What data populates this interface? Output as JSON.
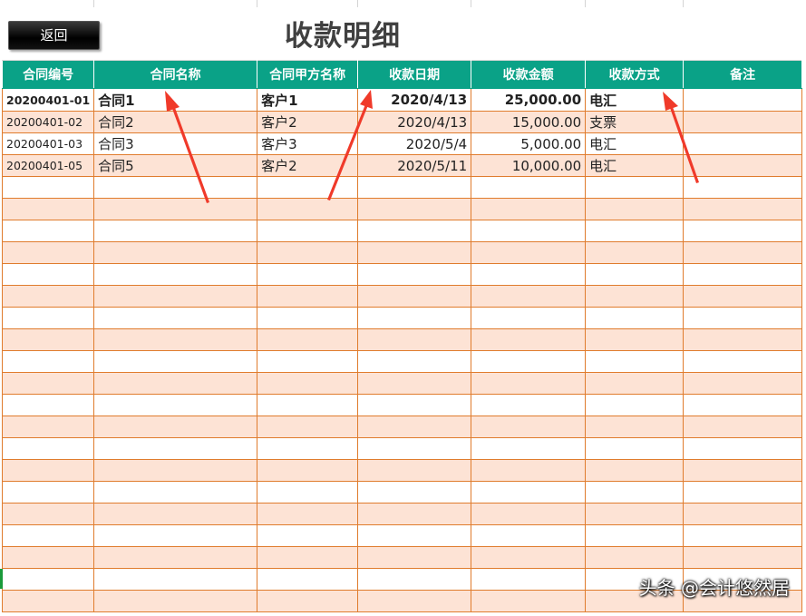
{
  "back_label": "返回",
  "title": "收款明细",
  "columns": [
    "合同编号",
    "合同名称",
    "合同甲方名称",
    "收款日期",
    "收款金额",
    "收款方式",
    "备注"
  ],
  "rows": [
    {
      "id": "20200401-01",
      "name": "合同1",
      "client": "客户1",
      "date": "2020/4/13",
      "amount": "25,000.00",
      "method": "电汇",
      "note": ""
    },
    {
      "id": "20200401-02",
      "name": "合同2",
      "client": "客户2",
      "date": "2020/4/13",
      "amount": "15,000.00",
      "method": "支票",
      "note": ""
    },
    {
      "id": "20200401-03",
      "name": "合同3",
      "client": "客户3",
      "date": "2020/5/4",
      "amount": "5,000.00",
      "method": "电汇",
      "note": ""
    },
    {
      "id": "20200401-05",
      "name": "合同5",
      "client": "客户2",
      "date": "2020/5/11",
      "amount": "10,000.00",
      "method": "电汇",
      "note": ""
    }
  ],
  "watermark": "头条 @会计悠然居",
  "colors": {
    "header_bg": "#0aa287",
    "stripe": "#fde3d5",
    "border": "#e07c2d",
    "arrow": "#f03a2a"
  }
}
